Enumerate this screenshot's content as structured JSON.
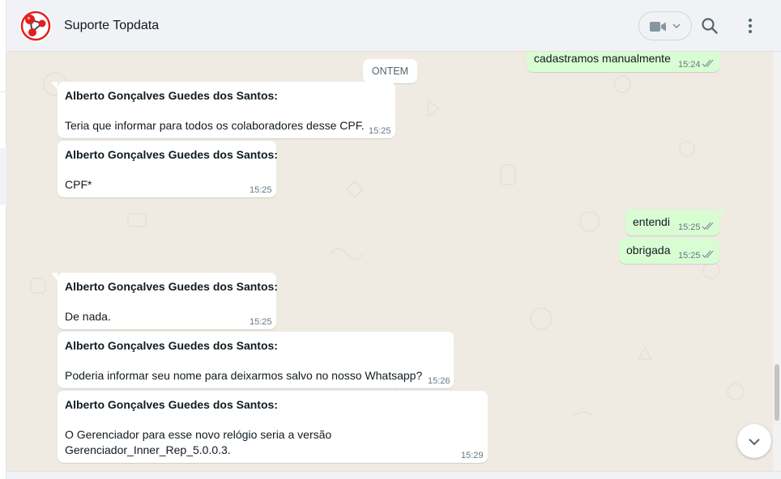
{
  "header": {
    "contact_name": "Suporte Topdata"
  },
  "date_divider": "ONTEM",
  "messages": [
    {
      "direction": "out",
      "text": "cadastramos manualmente",
      "time": "15:24",
      "status": "read"
    },
    {
      "direction": "in",
      "sender": "Alberto Gonçalves Guedes dos Santos:",
      "text": "Teria que informar para todos os colaboradores desse CPF.",
      "time": "15:25"
    },
    {
      "direction": "in",
      "sender": "Alberto Gonçalves Guedes dos Santos:",
      "text": "CPF*",
      "time": "15:25"
    },
    {
      "direction": "out",
      "text": "entendi",
      "time": "15:25",
      "status": "read"
    },
    {
      "direction": "out",
      "text": "obrigada",
      "time": "15:25",
      "status": "read"
    },
    {
      "direction": "in",
      "sender": "Alberto Gonçalves Guedes dos Santos:",
      "text": "De nada.",
      "time": "15:25"
    },
    {
      "direction": "in",
      "sender": "Alberto Gonçalves Guedes dos Santos:",
      "text": "Poderia informar seu nome para deixarmos salvo no nosso Whatsapp?",
      "time": "15:26"
    },
    {
      "direction": "in",
      "sender": "Alberto Gonçalves Guedes dos Santos:",
      "text_lines": [
        "O Gerenciador para esse novo relógio seria a versão",
        "Gerenciador_Inner_Rep_5.0.0.3."
      ],
      "time": "15:29"
    }
  ],
  "icons": {
    "header": [
      "topdata-logo-icon",
      "video-camera-icon",
      "chevron-down-icon",
      "search-icon",
      "menu-dots-icon"
    ],
    "chat": [
      "double-check-icon",
      "chevron-down-icon"
    ]
  },
  "colors": {
    "incoming_bubble": "#ffffff",
    "outgoing_bubble": "#d9fdd3",
    "chat_background": "#efeae2",
    "header_background": "#f0f2f5",
    "read_ticks": "#8696a0",
    "logo_red": "#e02020"
  }
}
